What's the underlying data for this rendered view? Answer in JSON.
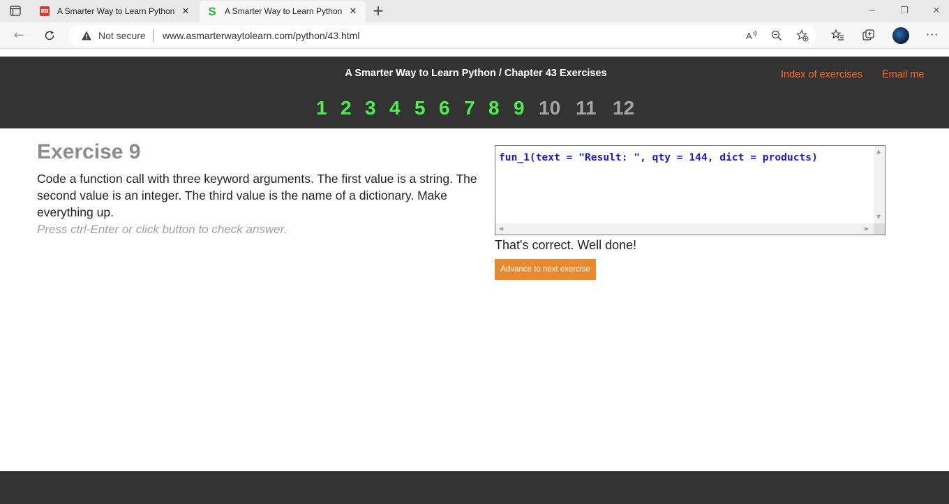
{
  "browser": {
    "tabs": [
      {
        "title": "A Smarter Way to Learn Python -",
        "favicon": "pdf-icon",
        "active": false
      },
      {
        "title": "A Smarter Way to Learn Python -",
        "favicon": "s-logo-icon",
        "active": true
      }
    ],
    "address": {
      "security_label": "Not secure",
      "url": "www.asmarterwaytolearn.com/python/43.html"
    }
  },
  "site": {
    "title": "A Smarter Way to Learn Python / Chapter 43 Exercises",
    "links": {
      "index": "Index of exercises",
      "email": "Email me"
    },
    "exercises": [
      {
        "num": "1",
        "status": "done"
      },
      {
        "num": "2",
        "status": "done"
      },
      {
        "num": "3",
        "status": "done"
      },
      {
        "num": "4",
        "status": "done"
      },
      {
        "num": "5",
        "status": "done"
      },
      {
        "num": "6",
        "status": "done"
      },
      {
        "num": "7",
        "status": "done"
      },
      {
        "num": "8",
        "status": "done"
      },
      {
        "num": "9",
        "status": "done"
      },
      {
        "num": "10",
        "status": "todo"
      },
      {
        "num": "11",
        "status": "todo"
      },
      {
        "num": "12",
        "status": "todo"
      }
    ],
    "colors": {
      "header_bg": "#333333",
      "done": "#4cf04c",
      "todo": "#a6a6a6",
      "link": "#ff6a2a",
      "button": "#e8892e"
    }
  },
  "exercise": {
    "title": "Exercise 9",
    "description": "Code a function call with three keyword arguments. The first value is a string. The second value is an integer. The third value is the name of a dictionary. Make everything up.",
    "hint": "Press ctrl-Enter or click button to check answer.",
    "answer_code": "fun_1(text = \"Result: \", qty = 144, dict = products)",
    "feedback": "That's correct. Well done!",
    "advance_label": "Advance to next exercise"
  }
}
